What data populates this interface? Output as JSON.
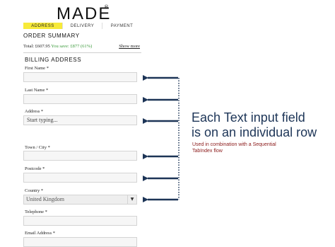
{
  "brand": {
    "name": "MADE",
    "mark": "®"
  },
  "tabs": [
    {
      "label": "ADDRESS",
      "active": true
    },
    {
      "label": "DELIVERY",
      "active": false
    },
    {
      "label": "PAYMENT",
      "active": false
    }
  ],
  "order_summary": {
    "heading": "ORDER SUMMARY",
    "total": "Total: £607.95",
    "savings": "You save: £877 (61%)",
    "show_more": "Show more"
  },
  "billing": {
    "heading": "BILLING ADDRESS",
    "fields": {
      "first_name": {
        "label": "First Name *",
        "value": ""
      },
      "last_name": {
        "label": "Last Name *",
        "value": ""
      },
      "address": {
        "label": "Address *",
        "placeholder": "Start typing..."
      },
      "town_city": {
        "label": "Town / City *",
        "value": ""
      },
      "postcode": {
        "label": "Postcode *",
        "value": ""
      },
      "country": {
        "label": "Country *",
        "value": "United Kingdom"
      },
      "telephone": {
        "label": "Telephone *",
        "value": ""
      },
      "email": {
        "label": "Email Address *",
        "value": ""
      }
    }
  },
  "annotation": {
    "title_line1": "Each Text input field",
    "title_line2": "is on an individual row",
    "sub_line1": "Used in combination with a Sequential",
    "sub_line2": "TabIndex flow",
    "title_color": "#1d3557",
    "sub_color": "#8b1a1a",
    "arrow_color": "#1d3557"
  }
}
